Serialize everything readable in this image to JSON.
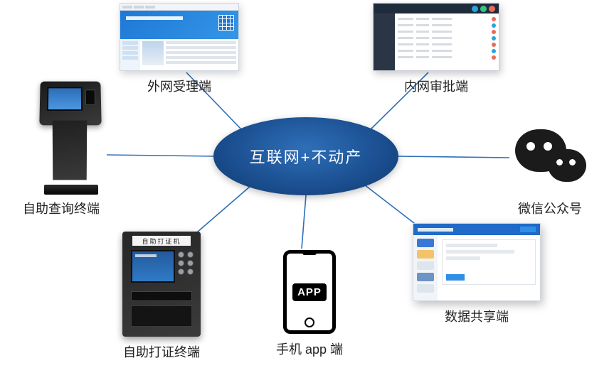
{
  "center": {
    "title": "互联网+不动产"
  },
  "nodes": {
    "external_portal": {
      "label": "外网受理端"
    },
    "internal_approval": {
      "label": "内网审批端"
    },
    "self_query_kiosk": {
      "label": "自助查询终端"
    },
    "wechat_account": {
      "label": "微信公众号"
    },
    "self_cert_printer": {
      "label": "自助打证终端",
      "device_plate": "自助打证机"
    },
    "mobile_app": {
      "label": "手机 app 端",
      "badge": "APP"
    },
    "data_sharing": {
      "label": "数据共享端"
    }
  },
  "colors": {
    "center_fill": "#1a4e8f",
    "line": "#2f6fb8"
  }
}
